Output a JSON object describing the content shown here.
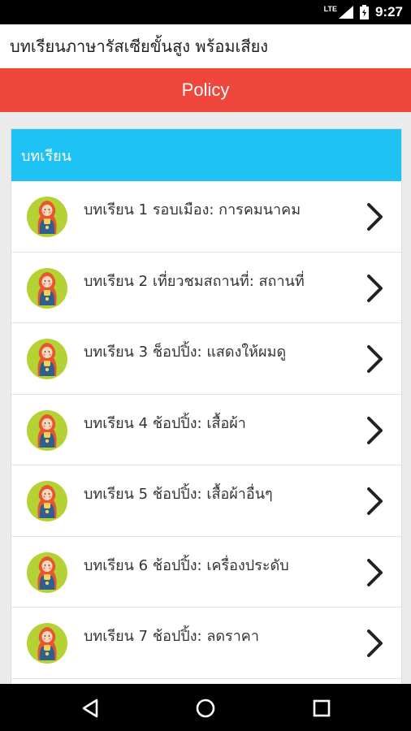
{
  "status_bar": {
    "network_label": "LTE",
    "time": "9:27",
    "icons": [
      "signal-icon",
      "battery-icon"
    ]
  },
  "app_bar": {
    "title": "บทเรียนภาษารัสเซียขั้นสูง พร้อมเสียง"
  },
  "policy": {
    "label": "Policy"
  },
  "lessons_card": {
    "header": "บทเรียน",
    "items": [
      {
        "label": "บทเรียน 1 รอบเมือง: การคมนาคม",
        "icon": "matryoshka-doll-icon"
      },
      {
        "label": "บทเรียน 2 เที่ยวชมสถานที่: สถานที่",
        "icon": "matryoshka-doll-icon"
      },
      {
        "label": "บทเรียน 3 ช็อปปิ้ง: แสดงให้ผมดู",
        "icon": "matryoshka-doll-icon"
      },
      {
        "label": "บทเรียน 4 ช้อปปิ้ง: เสื้อผ้า",
        "icon": "matryoshka-doll-icon"
      },
      {
        "label": "บทเรียน 5 ช้อปปิ้ง: เสื้อผ้าอื่นๆ",
        "icon": "matryoshka-doll-icon"
      },
      {
        "label": "บทเรียน 6 ช้อปปิ้ง: เครื่องประดับ",
        "icon": "matryoshka-doll-icon"
      },
      {
        "label": "บทเรียน 7 ช้อปปิ้ง: ลดราคา",
        "icon": "matryoshka-doll-icon"
      }
    ]
  },
  "nav_bar": {
    "buttons": [
      "back-icon",
      "home-icon",
      "recents-icon"
    ]
  },
  "colors": {
    "policy_bar": "#f0473d",
    "card_header": "#1ec3f3",
    "avatar_background": "#b5d234"
  }
}
